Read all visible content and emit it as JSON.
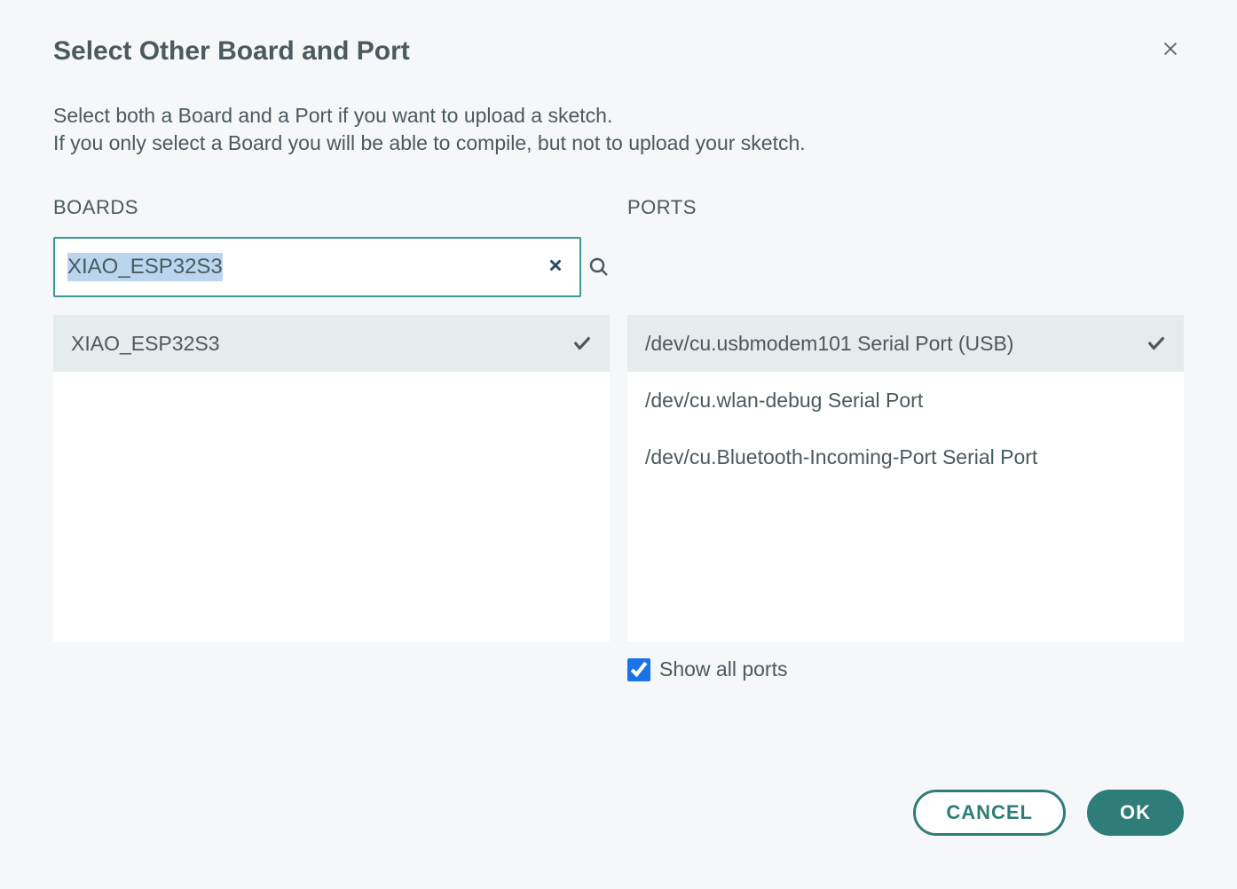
{
  "dialog": {
    "title": "Select Other Board and Port",
    "desc_line1": "Select both a Board and a Port if you want to upload a sketch.",
    "desc_line2": "If you only select a Board you will be able to compile, but not to upload your sketch."
  },
  "boards": {
    "header": "BOARDS",
    "search_value": "XIAO_ESP32S3",
    "items": [
      {
        "label": "XIAO_ESP32S3",
        "selected": true
      }
    ]
  },
  "ports": {
    "header": "PORTS",
    "items": [
      {
        "label": "/dev/cu.usbmodem101 Serial Port (USB)",
        "selected": true
      },
      {
        "label": "/dev/cu.wlan-debug Serial Port",
        "selected": false
      },
      {
        "label": "/dev/cu.Bluetooth-Incoming-Port Serial Port",
        "selected": false
      }
    ],
    "show_all_label": "Show all ports",
    "show_all_checked": true
  },
  "buttons": {
    "cancel": "CANCEL",
    "ok": "OK"
  }
}
